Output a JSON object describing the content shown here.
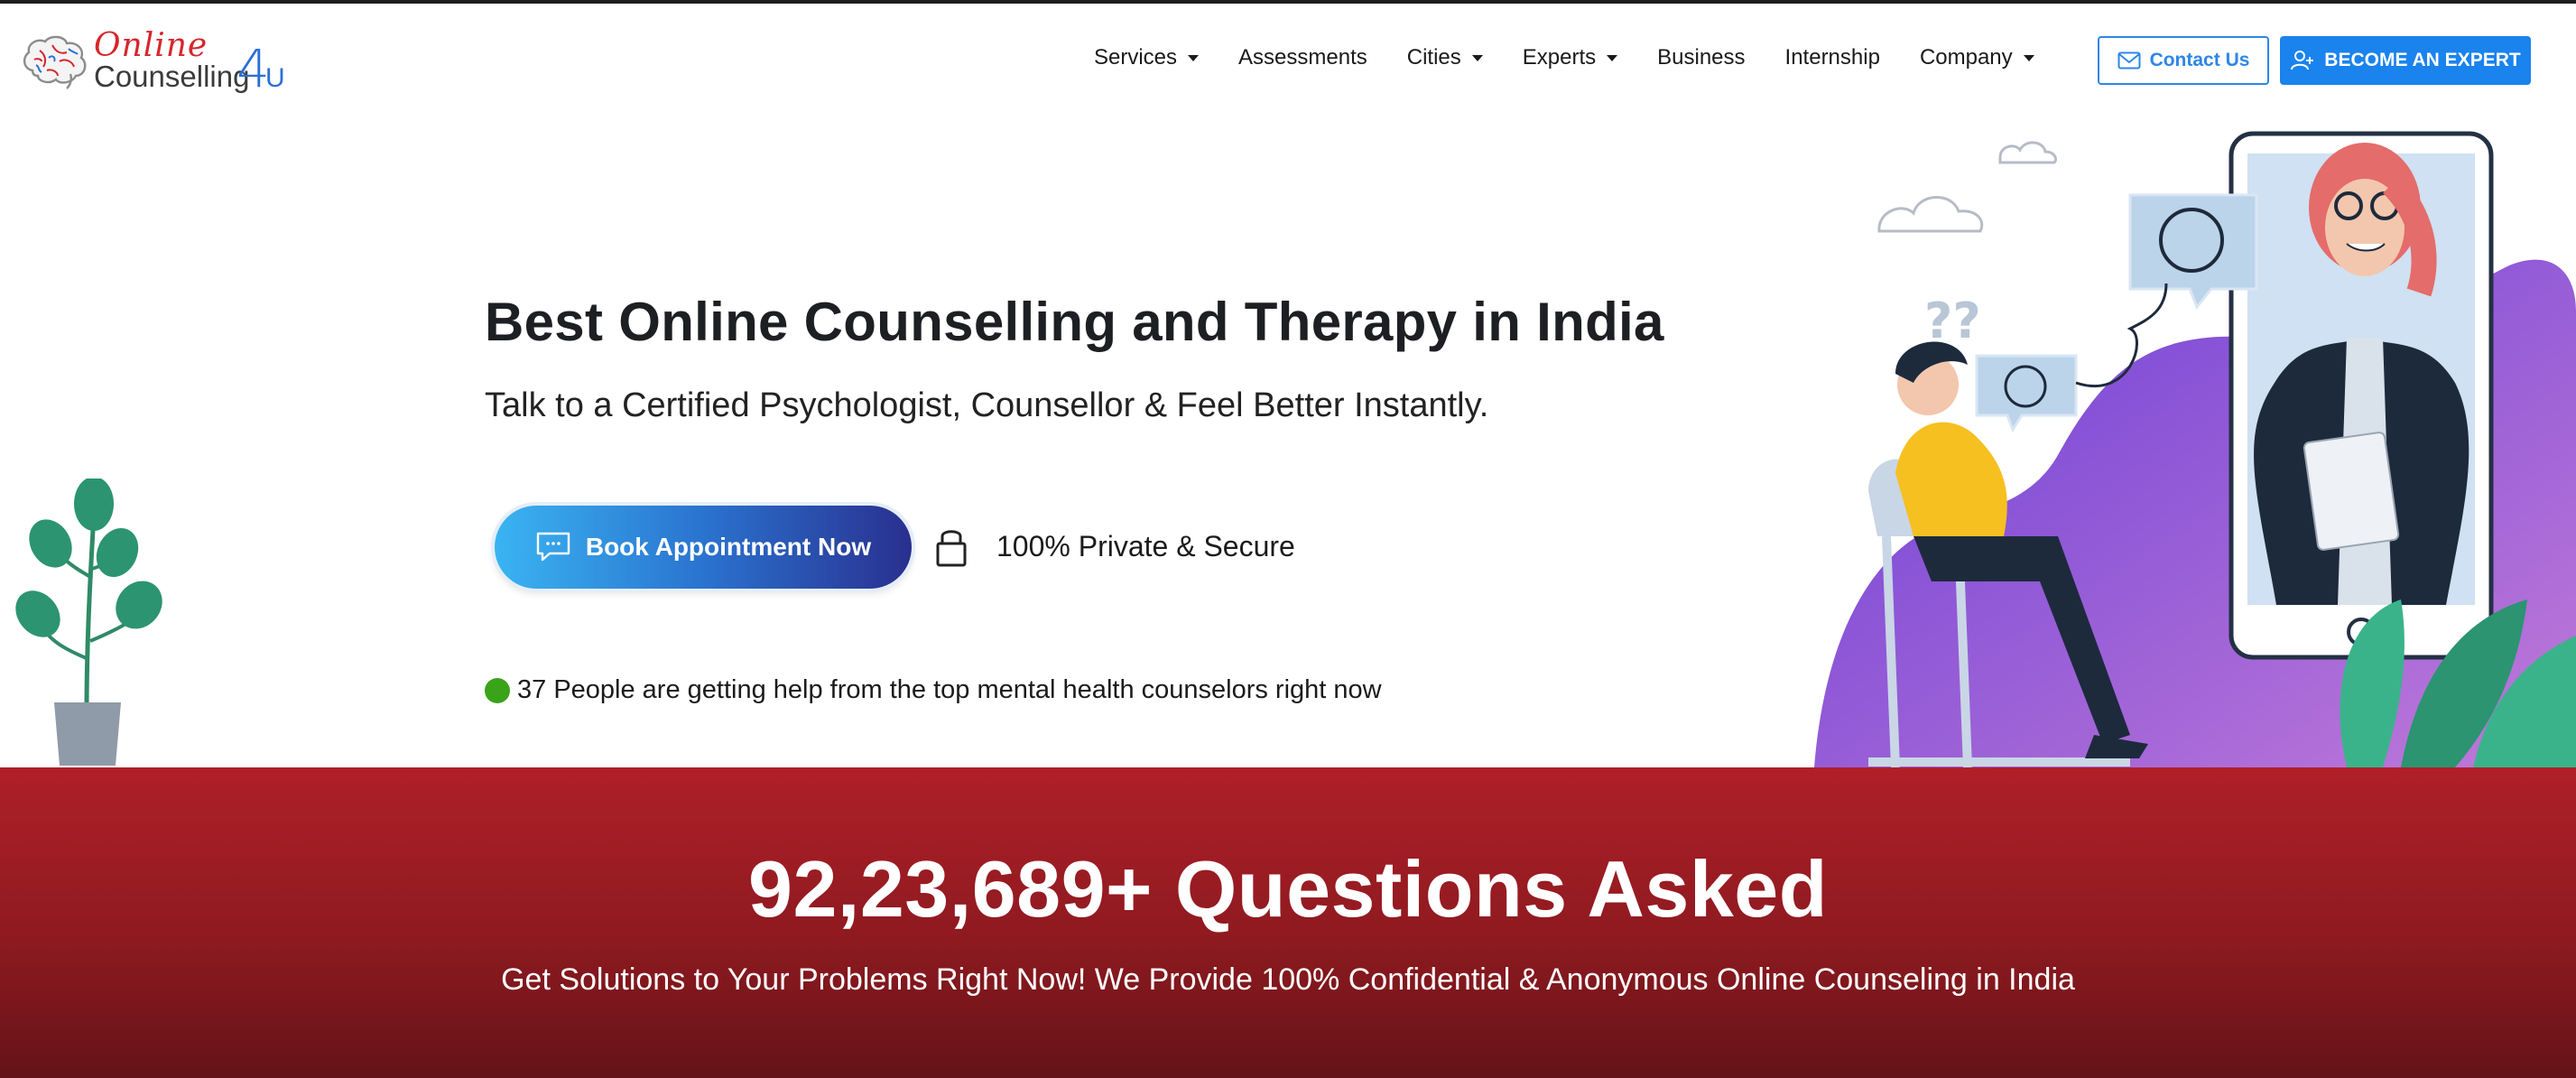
{
  "header": {
    "logo_line1": "Online",
    "logo_line2": "Counselling",
    "logo_4": "4",
    "logo_u": "U",
    "nav": [
      {
        "label": "Services",
        "dropdown": true
      },
      {
        "label": "Assessments",
        "dropdown": false
      },
      {
        "label": "Cities",
        "dropdown": true
      },
      {
        "label": "Experts",
        "dropdown": true
      },
      {
        "label": "Business",
        "dropdown": false
      },
      {
        "label": "Internship",
        "dropdown": false
      },
      {
        "label": "Company",
        "dropdown": true
      }
    ],
    "contact_label": "Contact Us",
    "expert_label": "BECOME AN EXPERT"
  },
  "hero": {
    "title": "Best Online Counselling and Therapy in India",
    "subtitle": "Talk to a Certified Psychologist, Counsellor & Feel Better Instantly.",
    "book_label": "Book Appointment Now",
    "secure_label": "100% Private & Secure",
    "live_text": "37 People are getting help from the top mental health counselors right now"
  },
  "banner": {
    "title": "92,23,689+ Questions Asked",
    "subtitle": "Get Solutions to Your Problems Right Now! We Provide 100% Confidential & Anonymous Online Counseling in India"
  },
  "colors": {
    "brand_red": "#d6262b",
    "brand_blue": "#1a83ee",
    "banner_red": "#a01d25",
    "live_green": "#3aa319"
  },
  "icons": {
    "logo": "brain-icon",
    "contact": "envelope-icon",
    "expert": "user-plus-icon",
    "book": "chat-bubble-icon",
    "secure": "lock-icon"
  }
}
